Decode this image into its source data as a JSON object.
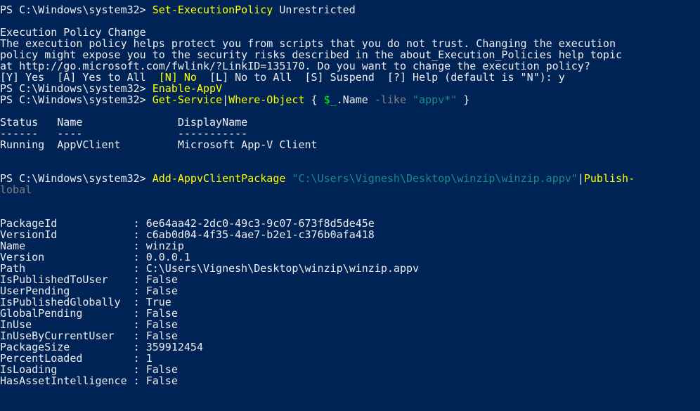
{
  "console": {
    "prompt": "PS C:\\Windows\\system32> ",
    "cmd1": {
      "name": "Set-ExecutionPolicy",
      "arg": " Unrestricted"
    },
    "policy_title": "Execution Policy Change",
    "policy_text": [
      "The execution policy helps protect you from scripts that you do not trust. Changing the execution",
      "policy might expose you to the security risks described in the about_Execution_Policies help topic",
      "at http://go.microsoft.com/fwlink/?LinkID=135170. Do you want to change the execution policy?"
    ],
    "choices": {
      "opt_y": "[Y] Yes  ",
      "opt_a": "[A] Yes to All  ",
      "opt_n": "[N] No",
      "opt_rest": "  [L] No to All  [S] Suspend  [?] Help (default is \"N\"): y"
    },
    "cmd2": {
      "name": "Enable-AppV"
    },
    "cmd3": {
      "name": "Get-Service",
      "pipe": "|",
      "name2": "Where-Object",
      "brace_open": " { ",
      "var": "$_",
      "prop": ".Name ",
      "op": "-like",
      "str": " \"appv*\"",
      "brace_close": " }"
    },
    "service_table": {
      "header": "Status   Name               DisplayName",
      "divider": "------   ----               -----------",
      "row": "Running  AppVClient         Microsoft App-V Client"
    },
    "cmd4": {
      "name": "Add-AppvClientPackage",
      "path": " \"C:\\Users\\Vignesh\\Desktop\\winzip\\winzip.appv\"",
      "pipe": "|",
      "name2": "Publish-",
      "wrap": "lobal"
    },
    "package_props": [
      {
        "key": "PackageId            ",
        "value": "6e64aa42-2dc0-49c3-9c07-673f8d5de45e"
      },
      {
        "key": "VersionId            ",
        "value": "c6ab0d04-4f35-4ae7-b2e1-c376b0afa418"
      },
      {
        "key": "Name                 ",
        "value": "winzip"
      },
      {
        "key": "Version              ",
        "value": "0.0.0.1"
      },
      {
        "key": "Path                 ",
        "value": "C:\\Users\\Vignesh\\Desktop\\winzip\\winzip.appv"
      },
      {
        "key": "IsPublishedToUser    ",
        "value": "False"
      },
      {
        "key": "UserPending          ",
        "value": "False"
      },
      {
        "key": "IsPublishedGlobally  ",
        "value": "True"
      },
      {
        "key": "GlobalPending        ",
        "value": "False"
      },
      {
        "key": "InUse                ",
        "value": "False"
      },
      {
        "key": "InUseByCurrentUser   ",
        "value": "False"
      },
      {
        "key": "PackageSize          ",
        "value": "359912454"
      },
      {
        "key": "PercentLoaded        ",
        "value": "1"
      },
      {
        "key": "IsLoading            ",
        "value": "False"
      },
      {
        "key": "HasAssetIntelligence ",
        "value": "False"
      }
    ],
    "colors": {
      "background": "#012456",
      "text": "#eeedf0",
      "command": "#ffff00",
      "parameter": "#808080",
      "string": "#1a8a8a",
      "variable": "#00ff00"
    }
  }
}
